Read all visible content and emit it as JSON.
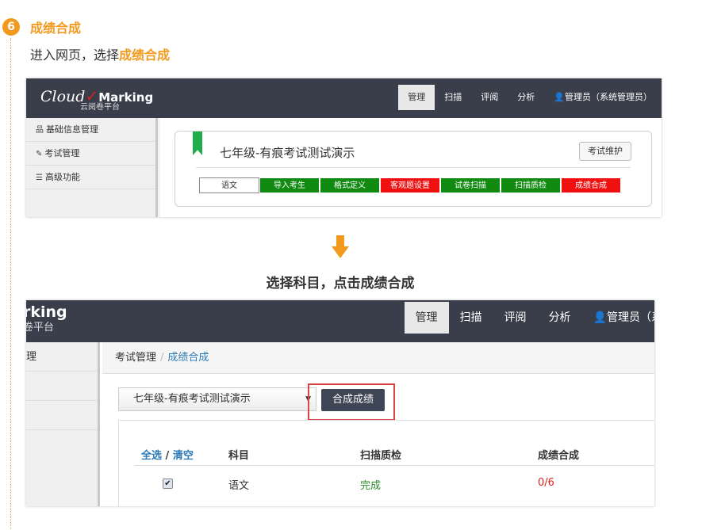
{
  "step": {
    "number": "6",
    "title": "成绩合成",
    "desc_prefix": "进入网页，选择",
    "desc_highlight": "成绩合成"
  },
  "shot1": {
    "logo": {
      "cloud": "Cloud",
      "marking": "Marking",
      "sub": "云阅卷平台"
    },
    "nav": [
      "管理",
      "扫描",
      "评阅",
      "分析",
      "管理员（系统管理员）"
    ],
    "sidebar": [
      "基础信息管理",
      "考试管理",
      "高级功能"
    ],
    "exam_title": "七年级-有痕考试测试演示",
    "maint_button": "考试维护",
    "steps": [
      "语文",
      "导入考生",
      "格式定义",
      "客观题设置",
      "试卷扫描",
      "扫描质检",
      "成绩合成"
    ]
  },
  "caption": "选择科目，点击成绩合成",
  "shot2": {
    "logo": {
      "marking": "rking",
      "sub": "卷平台"
    },
    "nav": [
      "管理",
      "扫描",
      "评阅",
      "分析",
      "管理员（系"
    ],
    "sidebar": [
      "理",
      "",
      ""
    ],
    "breadcrumb": {
      "parent": "考试管理",
      "sep": "/",
      "current": "成绩合成"
    },
    "select_value": "七年级-有痕考试测试演示",
    "compose_button": "合成成绩",
    "table": {
      "select_all": "全选",
      "slash": "/",
      "clear": "清空",
      "headers": [
        "科目",
        "扫描质检",
        "成绩合成"
      ],
      "rows": [
        {
          "subject": "语文",
          "scan_check": "完成",
          "score_compose": "0/6"
        }
      ]
    }
  },
  "colors": {
    "accent": "#f39a1e",
    "nav_bg": "#3a3d4a",
    "step_green": "#118a11",
    "step_red": "#f01010",
    "link_blue": "#2a7ab8"
  },
  "icons": {
    "user": "user-icon",
    "sitemap": "sitemap-icon",
    "edit": "edit-icon",
    "list": "list-icon",
    "caret": "caret-down-icon",
    "check": "check-icon"
  }
}
